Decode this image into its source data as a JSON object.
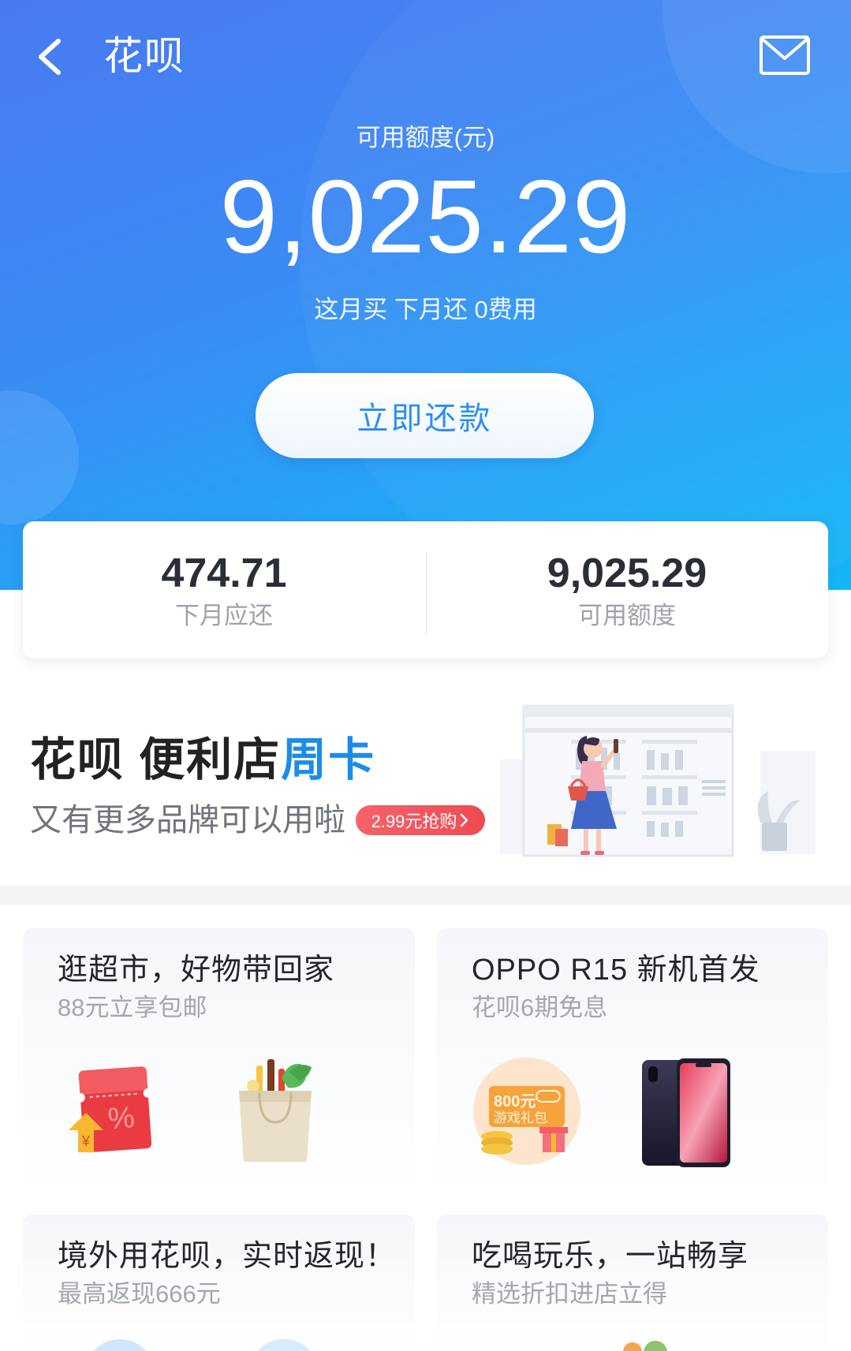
{
  "header": {
    "title": "花呗",
    "back_icon": "chevron-left-icon",
    "mail_icon": "mail-icon"
  },
  "balance": {
    "label": "可用额度(元)",
    "amount": "9,025.29",
    "note": "这月买 下月还 0费用",
    "repay_button": "立即还款"
  },
  "summary": [
    {
      "value": "474.71",
      "label": "下月应还"
    },
    {
      "value": "9,025.29",
      "label": "可用额度"
    }
  ],
  "promo": {
    "title_main": "花呗 便利店",
    "title_accent": "周卡",
    "subtitle": "又有更多品牌可以用啦",
    "cta": "2.99元抢购",
    "cta_icon": "chevron-right-icon",
    "illustration": "convenience-store-illustration"
  },
  "cards": [
    {
      "title": "逛超市，好物带回家",
      "subtitle": "88元立享包邮",
      "images": [
        "red-coupon-image",
        "tote-bag-image"
      ],
      "coupon_symbols": {
        "percent": "%",
        "yuan": "¥"
      }
    },
    {
      "title": "OPPO R15 新机首发",
      "subtitle": "花呗6期免息",
      "images": [
        "game-gift-coupon-image",
        "phone-image"
      ],
      "gift_amount": "800元",
      "gift_label": "游戏礼包"
    },
    {
      "title": "境外用花呗，实时返现！",
      "subtitle": "最高返现666元"
    },
    {
      "title": "吃喝玩乐，一站畅享",
      "subtitle": "精选折扣进店立得"
    }
  ],
  "colors": {
    "header_gradient_start": "#4a7af2",
    "header_gradient_end": "#14b6f6",
    "accent_blue": "#1d8ce8",
    "cta_red": "#ee4b52",
    "text_primary": "#23262c",
    "text_secondary": "#a3a7ae"
  }
}
